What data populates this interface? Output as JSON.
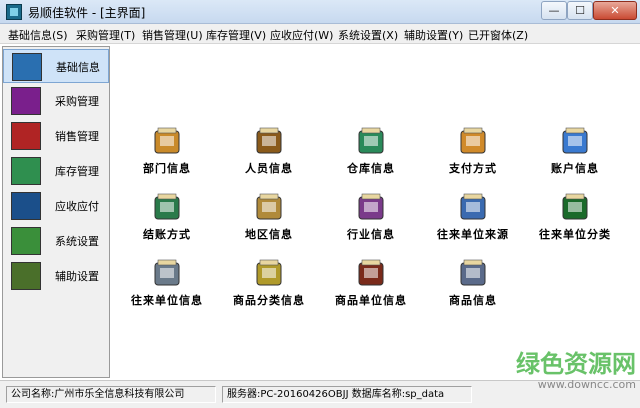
{
  "window": {
    "title": "易顺佳软件 - [主界面]",
    "min_glyph": "—",
    "max_glyph": "☐",
    "close_glyph": "✕"
  },
  "menu": [
    "基础信息(S)",
    "采购管理(T)",
    "销售管理(U)",
    "库存管理(V)",
    "应收应付(W)",
    "系统设置(X)",
    "辅助设置(Y)",
    "已开窗体(Z)"
  ],
  "sidebar": {
    "active_index": 0,
    "items": [
      {
        "label": "基础信息",
        "icon": "info-icon",
        "color": "#2a6fb0"
      },
      {
        "label": "采购管理",
        "icon": "purchase-icon",
        "color": "#7a1f8c"
      },
      {
        "label": "销售管理",
        "icon": "sales-icon",
        "color": "#b02424"
      },
      {
        "label": "库存管理",
        "icon": "inventory-icon",
        "color": "#2f8f4f"
      },
      {
        "label": "应收应付",
        "icon": "finance-icon",
        "color": "#1b4f8a"
      },
      {
        "label": "系统设置",
        "icon": "system-icon",
        "color": "#3a8f3a"
      },
      {
        "label": "辅助设置",
        "icon": "tools-icon",
        "color": "#4a6f2a"
      }
    ]
  },
  "tiles": [
    {
      "label": "部门信息",
      "icon": "department-icon",
      "color": "#c98a2a"
    },
    {
      "label": "人员信息",
      "icon": "staff-icon",
      "color": "#8a5a1a"
    },
    {
      "label": "仓库信息",
      "icon": "warehouse-icon",
      "color": "#2a8a5a"
    },
    {
      "label": "支付方式",
      "icon": "payment-icon",
      "color": "#d08a2a"
    },
    {
      "label": "账户信息",
      "icon": "account-icon",
      "color": "#3a7ad0"
    },
    {
      "label": "结账方式",
      "icon": "settlement-icon",
      "color": "#2a7a4a"
    },
    {
      "label": "地区信息",
      "icon": "region-icon",
      "color": "#b08a3a"
    },
    {
      "label": "行业信息",
      "icon": "industry-icon",
      "color": "#7a3a8a"
    },
    {
      "label": "往来单位来源",
      "icon": "partner-source-icon",
      "color": "#3a6ab0"
    },
    {
      "label": "往来单位分类",
      "icon": "partner-category-icon",
      "color": "#1a6a2a"
    },
    {
      "label": "往来单位信息",
      "icon": "partner-info-icon",
      "color": "#6a7a8a"
    },
    {
      "label": "商品分类信息",
      "icon": "product-category-icon",
      "color": "#b09a2a"
    },
    {
      "label": "商品单位信息",
      "icon": "product-unit-icon",
      "color": "#7a2a1a"
    },
    {
      "label": "商品信息",
      "icon": "product-icon",
      "color": "#5a6a8a"
    }
  ],
  "status": {
    "company": "公司名称:广州市乐全信息科技有限公司",
    "server": "服务器:PC-20160426OBJJ  数据库名称:sp_data"
  },
  "watermark": {
    "main": "绿色资源网",
    "url": "www.downcc.com"
  }
}
